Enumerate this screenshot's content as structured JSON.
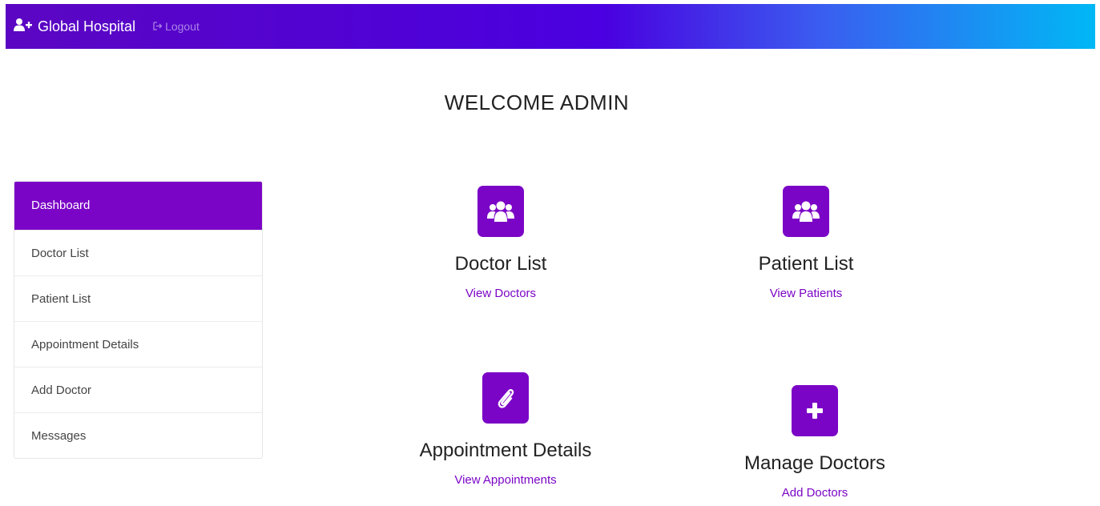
{
  "navbar": {
    "brand": "Global Hospital",
    "brand_icon": "user-plus-icon",
    "logout_label": "Logout",
    "logout_icon": "sign-out-icon"
  },
  "welcome": "WELCOME ADMIN",
  "sidebar": {
    "items": [
      {
        "label": "Dashboard",
        "active": true
      },
      {
        "label": "Doctor List",
        "active": false
      },
      {
        "label": "Patient List",
        "active": false
      },
      {
        "label": "Appointment Details",
        "active": false
      },
      {
        "label": "Add Doctor",
        "active": false
      },
      {
        "label": "Messages",
        "active": false
      }
    ]
  },
  "cards": [
    {
      "title": "Doctor List",
      "link": "View Doctors",
      "icon": "users-icon"
    },
    {
      "title": "Patient List",
      "link": "View Patients",
      "icon": "users-icon"
    },
    {
      "title": "Appointment Details",
      "link": "View Appointments",
      "icon": "paperclip-icon"
    },
    {
      "title": "Manage Doctors",
      "link": "Add Doctors",
      "icon": "plus-icon"
    }
  ],
  "colors": {
    "accent": "#7b05c6",
    "navbar_start": "#5b06c2",
    "navbar_end": "#00b8f5"
  }
}
